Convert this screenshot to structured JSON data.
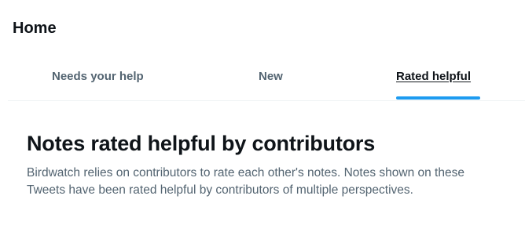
{
  "header": {
    "title": "Home"
  },
  "tabs": [
    {
      "label": "Needs your help",
      "active": false
    },
    {
      "label": "New",
      "active": false
    },
    {
      "label": "Rated helpful",
      "active": true
    }
  ],
  "section": {
    "title": "Notes rated helpful by contributors",
    "description": "Birdwatch relies on contributors to rate each other's notes. Notes shown on these Tweets have been rated helpful by contributors of multiple perspectives."
  },
  "colors": {
    "accent": "#1d9bf0",
    "text_primary": "#0f1419",
    "text_secondary": "#536471",
    "divider": "#eff3f4"
  }
}
